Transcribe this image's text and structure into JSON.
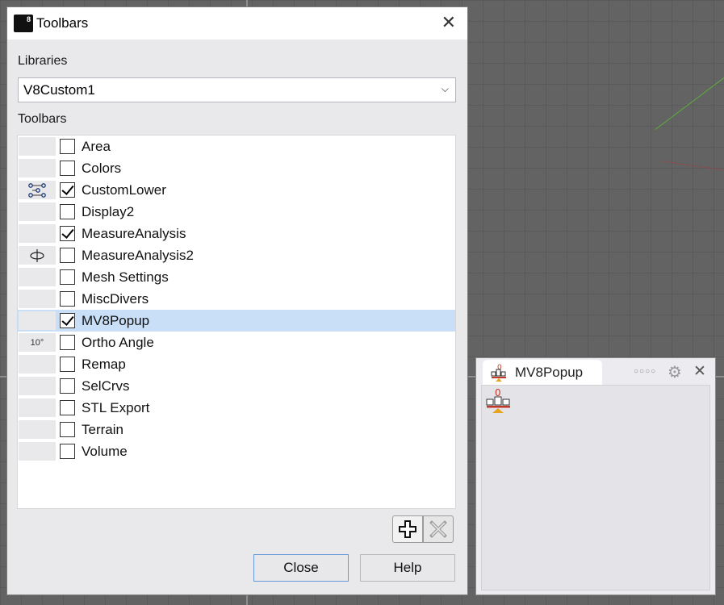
{
  "dialog": {
    "title": "Toolbars",
    "libraries_label": "Libraries",
    "library_selected": "V8Custom1",
    "toolbars_label": "Toolbars",
    "items": [
      {
        "label": "Area",
        "checked": false,
        "thumb": ""
      },
      {
        "label": "Colors",
        "checked": false,
        "thumb": ""
      },
      {
        "label": "CustomLower",
        "checked": true,
        "thumb": "network-icon"
      },
      {
        "label": "Display2",
        "checked": false,
        "thumb": ""
      },
      {
        "label": "MeasureAnalysis",
        "checked": true,
        "thumb": ""
      },
      {
        "label": "MeasureAnalysis2",
        "checked": false,
        "thumb": "ellipse-axis-icon"
      },
      {
        "label": "Mesh Settings",
        "checked": false,
        "thumb": ""
      },
      {
        "label": "MiscDivers",
        "checked": false,
        "thumb": ""
      },
      {
        "label": "MV8Popup",
        "checked": true,
        "thumb": "",
        "selected": true
      },
      {
        "label": "Ortho Angle",
        "checked": false,
        "thumb_text": "10°"
      },
      {
        "label": "Remap",
        "checked": false,
        "thumb": ""
      },
      {
        "label": "SelCrvs",
        "checked": false,
        "thumb": ""
      },
      {
        "label": "STL Export",
        "checked": false,
        "thumb": ""
      },
      {
        "label": "Terrain",
        "checked": false,
        "thumb": ""
      },
      {
        "label": "Volume",
        "checked": false,
        "thumb": ""
      }
    ],
    "close_button": "Close",
    "help_button": "Help"
  },
  "panel": {
    "tab_label": "MV8Popup",
    "icon_label": "0"
  },
  "colors": {
    "accent": "#6a9ad8",
    "selection": "#c9dff8",
    "viewport": "#636363"
  }
}
